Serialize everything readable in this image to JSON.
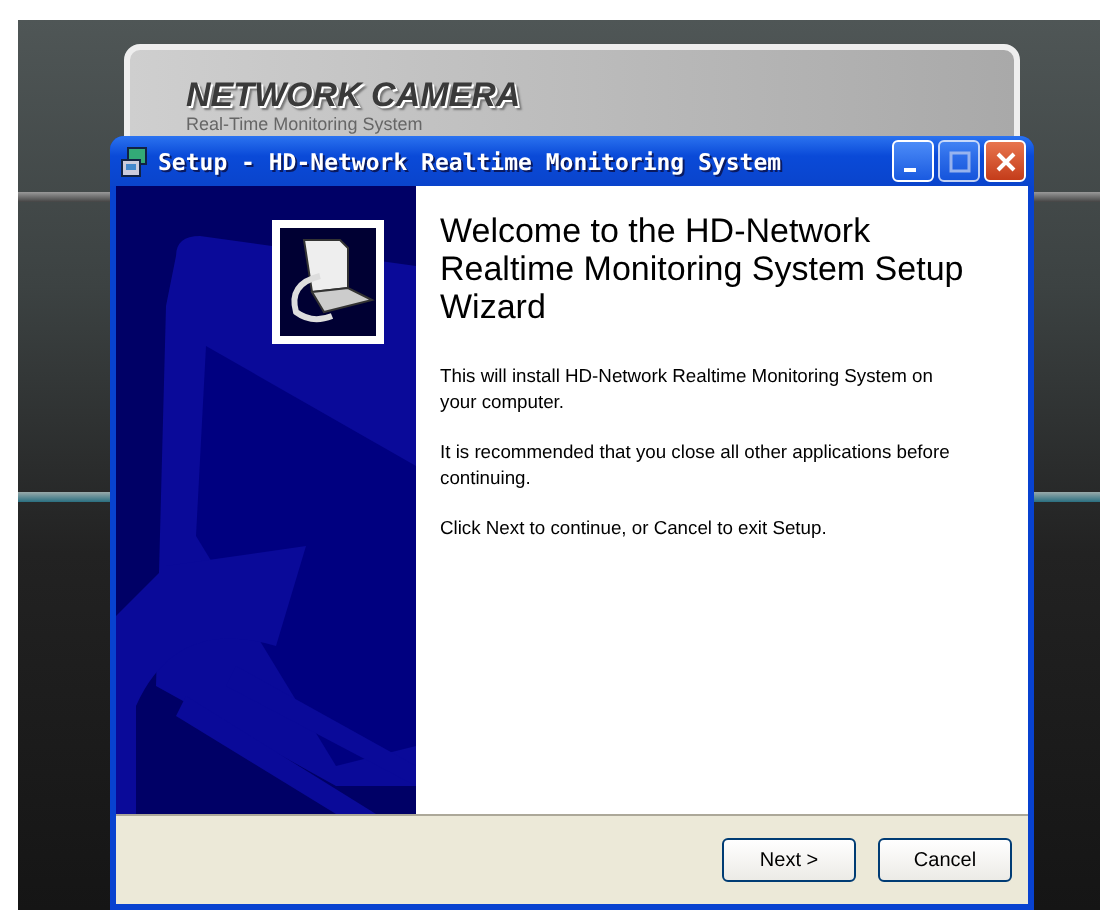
{
  "background_app": {
    "logo": "NETWORK CAMERA",
    "subtitle": "Real-Time Monitoring System"
  },
  "window": {
    "title": "Setup - HD-Network Realtime Monitoring System"
  },
  "wizard": {
    "heading": "Welcome to the HD-Network Realtime Monitoring System Setup Wizard",
    "paragraphs": [
      "This will install HD-Network Realtime Monitoring System on your computer.",
      "It is recommended that you close all other applications before continuing.",
      "Click Next to continue, or Cancel to exit Setup."
    ]
  },
  "buttons": [
    {
      "label": "Next >"
    },
    {
      "label": "Cancel"
    }
  ]
}
